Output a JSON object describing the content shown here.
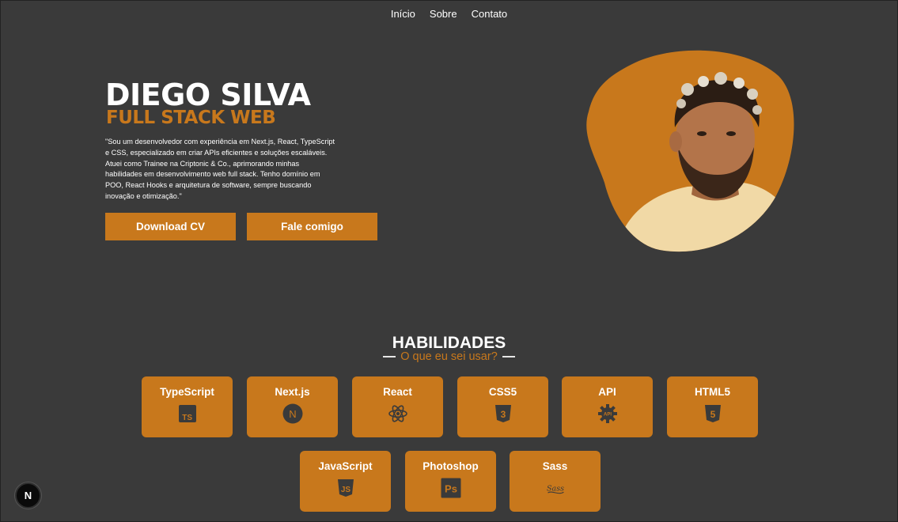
{
  "nav": {
    "items": [
      "Início",
      "Sobre",
      "Contato"
    ]
  },
  "hero": {
    "name": "DIEGO SILVA",
    "role": "FULL STACK WEB",
    "bio": "\"Sou um desenvolvedor com experiência em Next.js, React, TypeScript e CSS, especializado em criar APIs eficientes e soluções escaláveis. Atuei como Trainee na Criptonic & Co., aprimorando minhas habilidades em desenvolvimento web full stack. Tenho domínio em POO, React Hooks e arquitetura de software, sempre buscando inovação e otimização.\"",
    "buttons": {
      "download_cv": "Download CV",
      "contact": "Fale comigo"
    }
  },
  "skills": {
    "title": "HABILIDADES",
    "subtitle": "O que eu sei usar?",
    "items": [
      {
        "label": "TypeScript",
        "icon": "typescript-icon",
        "icon_text": "TS"
      },
      {
        "label": "Next.js",
        "icon": "nextjs-icon",
        "icon_text": "N"
      },
      {
        "label": "React",
        "icon": "react-icon"
      },
      {
        "label": "CSS5",
        "icon": "css3-icon",
        "icon_text": "3"
      },
      {
        "label": "API",
        "icon": "api-gear-icon",
        "icon_text": "API"
      },
      {
        "label": "HTML5",
        "icon": "html5-icon",
        "icon_text": "5"
      },
      {
        "label": "JavaScript",
        "icon": "javascript-icon",
        "icon_text": "JS"
      },
      {
        "label": "Photoshop",
        "icon": "photoshop-icon",
        "icon_text": "Ps"
      },
      {
        "label": "Sass",
        "icon": "sass-icon",
        "icon_text": "Sass"
      }
    ]
  },
  "next_badge": {
    "icon": "nextjs-dev-indicator-icon",
    "text": "N"
  },
  "colors": {
    "background": "#3a3a3a",
    "accent": "#c8781c",
    "icon_dark": "#3a3a3a",
    "text": "#ffffff"
  }
}
